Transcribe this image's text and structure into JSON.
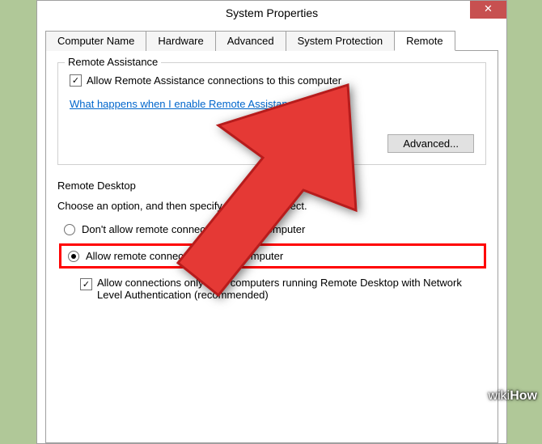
{
  "title": "System Properties",
  "tabs": {
    "computer_name": "Computer Name",
    "hardware": "Hardware",
    "advanced": "Advanced",
    "system_protection": "System Protection",
    "remote": "Remote"
  },
  "remote_assistance": {
    "legend": "Remote Assistance",
    "checkbox_label": "Allow Remote Assistance connections to this computer",
    "link": "What happens when I enable Remote Assistance?",
    "advanced_btn": "Advanced..."
  },
  "remote_desktop": {
    "legend": "Remote Desktop",
    "desc": "Choose an option, and then specify who can connect.",
    "radio_dont": "Don't allow remote connections to this computer",
    "radio_allow": "Allow remote connections to this computer",
    "nla_check": "Allow connections only from computers running Remote Desktop with Network Level Authentication (recommended)"
  },
  "checkmark": "✓",
  "close": "✕",
  "watermark_a": "wiki",
  "watermark_b": "How"
}
